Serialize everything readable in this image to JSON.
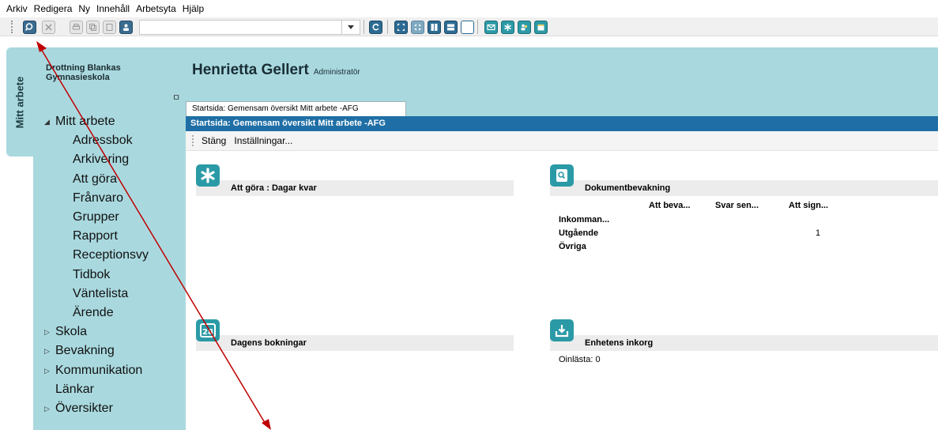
{
  "menu": [
    "Arkiv",
    "Redigera",
    "Ny",
    "Innehåll",
    "Arbetsyta",
    "Hjälp"
  ],
  "side_tab": {
    "label": "Mitt arbete"
  },
  "org": {
    "name_line1": "Drottning Blankas",
    "name_line2": "Gymnasieskola"
  },
  "nav": {
    "root": "Mitt arbete",
    "children": [
      "Adressbok",
      "Arkivering",
      "Att göra",
      "Frånvaro",
      "Grupper",
      "Rapport",
      "Receptionsvy",
      "Tidbok",
      "Väntelista",
      "Ärende"
    ],
    "collapsed": [
      "Skola",
      "Bevakning",
      "Kommunikation"
    ],
    "plain": "Länkar",
    "last": "Översikter"
  },
  "header": {
    "user_name": "Henrietta Gellert",
    "role": "Administratör"
  },
  "doc": {
    "tab_label": "Startsida: Gemensam översikt Mitt arbete -AFG",
    "title": "Startsida: Gemensam översikt Mitt arbete -AFG",
    "cmd_close": "Stäng",
    "cmd_settings": "Inställningar..."
  },
  "widgets": {
    "todo": {
      "title": "Att göra : Dagar kvar"
    },
    "docwatch": {
      "title": "Dokumentbevakning",
      "columns": [
        "Att beva...",
        "Svar sen...",
        "Att sign..."
      ],
      "rows": [
        {
          "label": "Inkomman...",
          "sign": ""
        },
        {
          "label": "Utgående",
          "sign": "1"
        },
        {
          "label": "Övriga",
          "sign": ""
        }
      ]
    },
    "bookings": {
      "title": "Dagens bokningar",
      "icon_text": "28"
    },
    "inbox": {
      "title": "Enhetens inkorg",
      "unread": "Oinlästa: 0"
    }
  },
  "colors": {
    "panel_teal": "#a9d9df",
    "title_blue": "#1f6fa6",
    "icon_teal": "#2a9aa6",
    "arrow_red": "#c00000"
  }
}
